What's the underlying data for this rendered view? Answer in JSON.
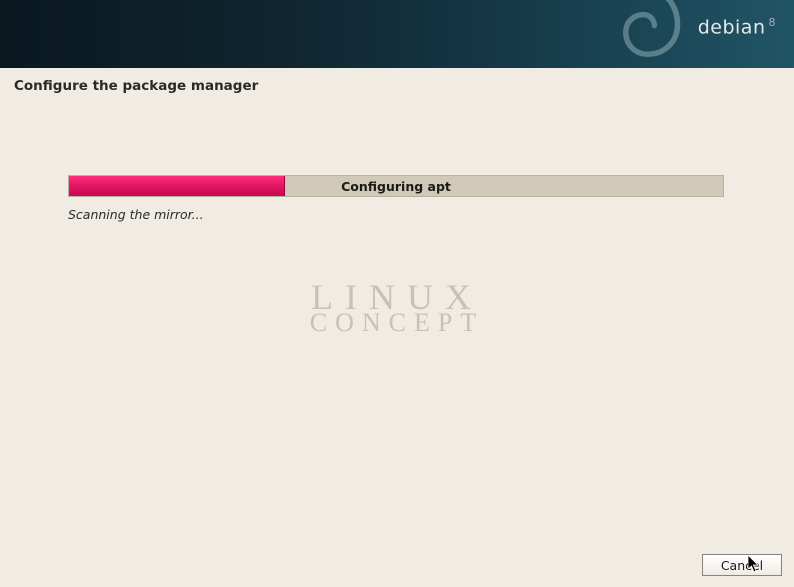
{
  "header": {
    "brand_name": "debian",
    "brand_version": "8"
  },
  "page": {
    "title": "Configure the package manager"
  },
  "progress": {
    "label": "Configuring apt",
    "percent": 33,
    "status": "Scanning the mirror..."
  },
  "watermark": {
    "line1": "LINUX",
    "line2": "CONCEPT"
  },
  "footer": {
    "cancel_label": "Cancel"
  }
}
